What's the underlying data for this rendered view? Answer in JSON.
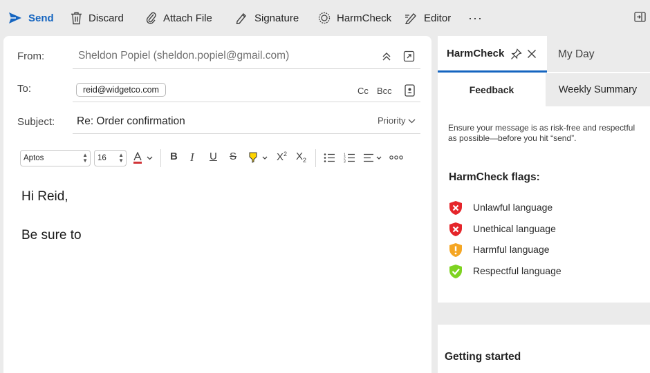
{
  "toolbar": {
    "send": "Send",
    "discard": "Discard",
    "attach": "Attach File",
    "signature": "Signature",
    "harmcheck": "HarmCheck",
    "editor": "Editor",
    "more": "···"
  },
  "compose": {
    "from_label": "From:",
    "from_value": "Sheldon Popiel (sheldon.popiel@gmail.com)",
    "to_label": "To:",
    "to_recipient": "reid@widgetco.com",
    "cc": "Cc",
    "bcc": "Bcc",
    "subject_label": "Subject:",
    "subject_value": "Re: Order confirmation",
    "priority": "Priority",
    "font_name": "Aptos",
    "font_size": "16",
    "body_line1": "Hi Reid,",
    "body_line2": "Be sure to"
  },
  "panel": {
    "title": "HarmCheck",
    "other_tab": "My Day",
    "subtab_active": "Feedback",
    "subtab_other": "Weekly Summary",
    "intro": "Ensure your message is as risk-free and respectful as possible—before you hit “send”.",
    "flags_title": "HarmCheck flags:",
    "flags": [
      {
        "label": "Unlawful language",
        "status": "fail"
      },
      {
        "label": "Unethical language",
        "status": "fail"
      },
      {
        "label": "Harmful language",
        "status": "warn"
      },
      {
        "label": "Respectful language",
        "status": "pass"
      }
    ],
    "getting_started": "Getting started"
  },
  "colors": {
    "accent": "#1565c0",
    "fail": "#e5252a",
    "warn": "#f5a623",
    "pass": "#7ed321",
    "font_color_red": "#d13438",
    "highlight_yellow": "#ffd400"
  }
}
